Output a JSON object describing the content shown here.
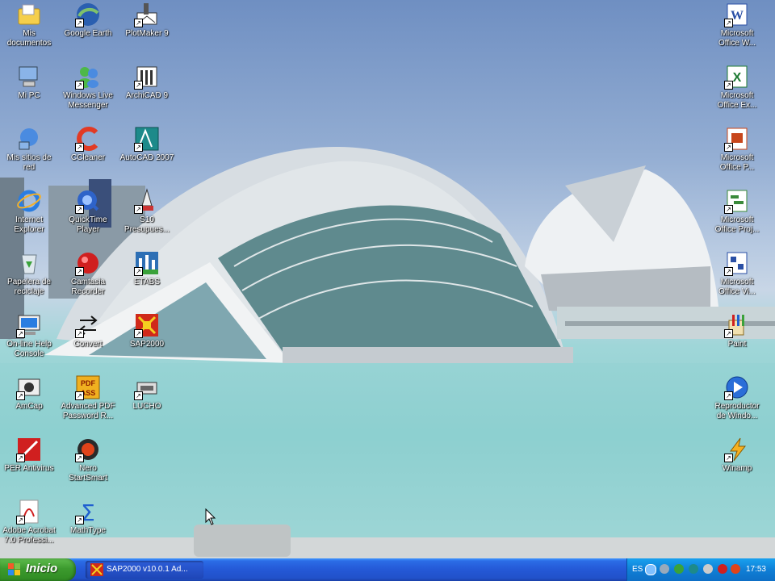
{
  "desktop": {
    "icons_left": [
      {
        "name": "my-documents-icon",
        "label": "Mis\ndocumentos"
      },
      {
        "name": "google-earth-icon",
        "label": "Google Earth"
      },
      {
        "name": "plotmaker-icon",
        "label": "PlotMaker 9"
      },
      {
        "name": "my-computer-icon",
        "label": "Mi PC"
      },
      {
        "name": "windows-live-messenger-icon",
        "label": "Windows Live\nMessenger"
      },
      {
        "name": "archicad-icon",
        "label": "ArchiCAD 9"
      },
      {
        "name": "network-places-icon",
        "label": "Mis sitios de\nred"
      },
      {
        "name": "ccleaner-icon",
        "label": "CCleaner"
      },
      {
        "name": "autocad-icon",
        "label": "AutoCAD 2007"
      },
      {
        "name": "internet-explorer-icon",
        "label": "Internet\nExplorer"
      },
      {
        "name": "quicktime-icon",
        "label": "QuickTime\nPlayer"
      },
      {
        "name": "s10-presupuestos-icon",
        "label": "S10\nPresupues..."
      },
      {
        "name": "recycle-bin-icon",
        "label": "Papelera de\nreciclaje"
      },
      {
        "name": "camtasia-recorder-icon",
        "label": "Camtasia\nRecorder"
      },
      {
        "name": "etabs-icon",
        "label": "ETABS"
      },
      {
        "name": "online-help-console-icon",
        "label": "On-line Help\nConsole"
      },
      {
        "name": "convert-icon",
        "label": "Convert"
      },
      {
        "name": "sap2000-icon",
        "label": "SAP2000"
      },
      {
        "name": "amcap-icon",
        "label": "AmCap"
      },
      {
        "name": "advanced-pdf-password-icon",
        "label": "Advanced PDF\nPassword R..."
      },
      {
        "name": "lucho-icon",
        "label": "LUCHO"
      },
      {
        "name": "per-antivirus-icon",
        "label": "PER Antivirus"
      },
      {
        "name": "nero-startsmart-icon",
        "label": "Nero\nStartSmart"
      },
      {
        "name": "adobe-acrobat-icon",
        "label": "Adobe Acrobat\n7.0 Professi..."
      },
      {
        "name": "mathtype-icon",
        "label": "MathType"
      }
    ],
    "icons_right": [
      {
        "name": "office-word-icon",
        "label": "Microsoft\nOffice W..."
      },
      {
        "name": "office-excel-icon",
        "label": "Microsoft\nOffice Ex..."
      },
      {
        "name": "office-powerpoint-icon",
        "label": "Microsoft\nOffice P..."
      },
      {
        "name": "office-project-icon",
        "label": "Microsoft\nOffice Proj..."
      },
      {
        "name": "office-visio-icon",
        "label": "Microsoft\nOffice Vi..."
      },
      {
        "name": "paint-icon",
        "label": "Paint"
      },
      {
        "name": "windows-media-player-icon",
        "label": "Reproductor\nde Windo..."
      },
      {
        "name": "winamp-icon",
        "label": "Winamp"
      }
    ]
  },
  "taskbar": {
    "start_label": "Inicio",
    "task_label": "SAP2000 v10.0.1  Ad...",
    "language": "ES",
    "clock": "17:53"
  },
  "colors": {
    "taskbar": "#2458d6",
    "start": "#3c9a2e",
    "tray": "#0f7fd6"
  }
}
